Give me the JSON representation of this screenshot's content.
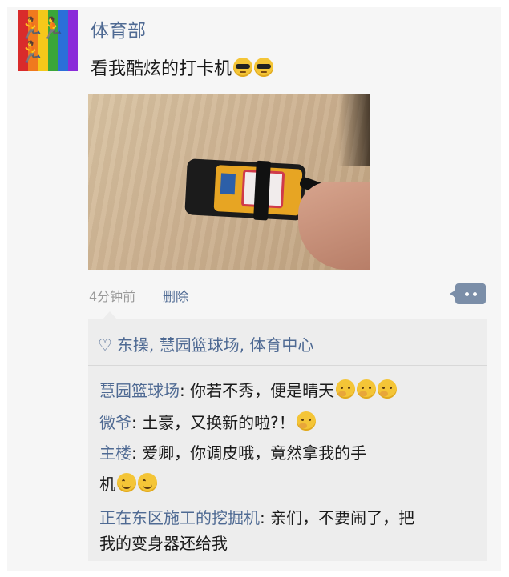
{
  "post": {
    "username": "体育部",
    "text": "看我酷炫的打卡机",
    "text_emojis": [
      "cool-emoji",
      "cool-emoji"
    ],
    "time": "4分钟前",
    "delete_label": "删除",
    "avatar_colors": [
      "#d92b2b",
      "#f07a1e",
      "#f5c81a",
      "#3aa63a",
      "#2b6fd9",
      "#8a2bd9"
    ]
  },
  "likes": {
    "text": "东操, 慧园篮球场, 体育中心"
  },
  "comments": [
    {
      "author": "慧园篮球场",
      "text": ": 你若不秀，便是晴天"
    },
    {
      "author": "微爷",
      "text": ": 土豪，又换新的啦?！"
    },
    {
      "author": "主楼",
      "text": ": 爱卿，你调皮哦，竟然拿我的手",
      "text2": "机"
    },
    {
      "author": "正在东区施工的挖掘机",
      "text": ": 亲们，不要闹了，把",
      "text2": "我的变身器还给我"
    }
  ],
  "colors": {
    "link": "#4f6a93",
    "panel": "#ededed"
  }
}
